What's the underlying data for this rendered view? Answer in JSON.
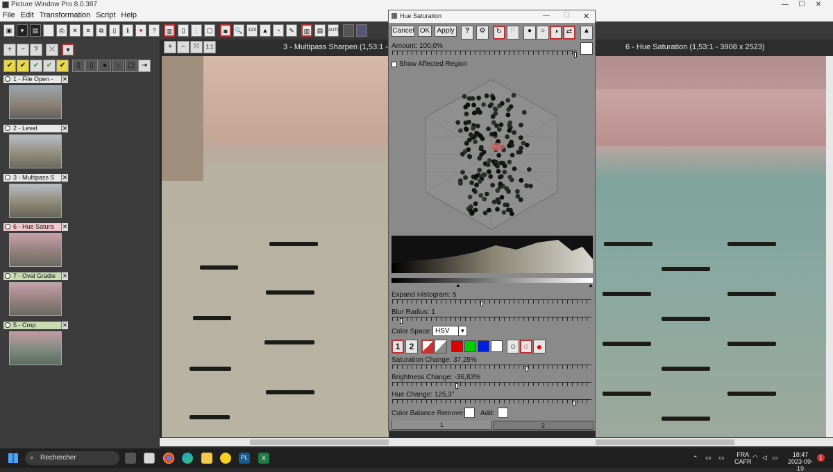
{
  "app": {
    "title": "Picture Window Pro 8.0.387",
    "window_controls": [
      "—",
      "☐",
      "✕"
    ]
  },
  "menu": [
    "File",
    "Edit",
    "Transformation",
    "Script",
    "Help"
  ],
  "history": [
    {
      "label": "1 - File Open -",
      "style": "plain"
    },
    {
      "label": "2 - Level",
      "style": "plain"
    },
    {
      "label": "3 - Multipass S",
      "style": "plain"
    },
    {
      "label": "6 - Hue Satura",
      "style": "plain"
    },
    {
      "label": "7 - Oval Gradie",
      "style": "green"
    },
    {
      "label": "5 - Crop",
      "style": "green"
    }
  ],
  "panes": {
    "left_title": "3 - Multipass Sharpen (1,53:1 - 3908 x 2523)",
    "left_visible_title": "3 - Multipass Sharpen (1,53:1 - 3…",
    "right_title": "6 - Hue Saturation (1,53:1 - 3908 x 2523)",
    "zoom_buttons": [
      "1:1"
    ],
    "corner_mark": "24"
  },
  "dialog": {
    "title": "Hue Saturation",
    "cancel": "Cancel",
    "ok": "OK",
    "apply": "Apply",
    "help": "?",
    "amount_label": "Amount: 100,0%",
    "amount_value": 1.0,
    "show_affected": "Show Affected Region",
    "show_affected_checked": false,
    "expand_label": "Expand Histogram: 5",
    "expand_value": 0.45,
    "blur_label": "Blur Radius: 1",
    "blur_value": 0.04,
    "color_space_label": "Color Space:",
    "color_space_value": "HSV",
    "mode_buttons": [
      "1",
      "2"
    ],
    "saturation_label": "Saturation Change: 37,25%",
    "saturation_value": 0.68,
    "brightness_label": "Brightness Change: -36,83%",
    "brightness_value": 0.32,
    "hue_label": "Hue Change: 125,3°",
    "hue_value": 0.92,
    "balance_remove": "Color Balance Remove:",
    "balance_add": "Add:",
    "tabs": [
      "1",
      "2"
    ]
  },
  "taskbar": {
    "search": "Rechercher",
    "lang1": "FRA",
    "lang2": "CAFR",
    "time": "18:47",
    "date": "2023-09-19",
    "badge": "1"
  }
}
